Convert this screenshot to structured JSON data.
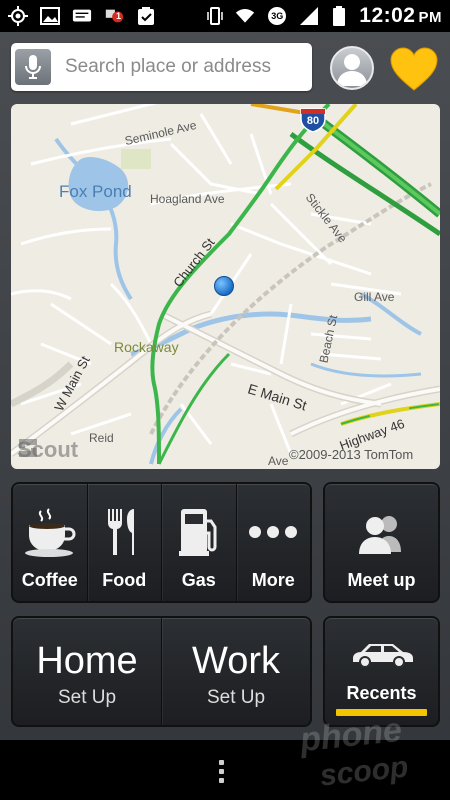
{
  "status_bar": {
    "icons": [
      "gps-icon",
      "image-icon",
      "message-icon",
      "notification-badge-icon",
      "clipboard-check-icon"
    ],
    "notification_count": "1",
    "right_icons": [
      "vibrate-icon",
      "wifi-icon",
      "3g-icon",
      "signal-icon",
      "battery-icon"
    ],
    "network": "3G",
    "time": "12:02",
    "ampm": "PM"
  },
  "search": {
    "placeholder": "Search place or address"
  },
  "map": {
    "labels": {
      "fox_pond": "Fox Pond",
      "rockaway": "Rockaway",
      "hoagland": "Hoagland Ave",
      "seminole": "Seminole Ave",
      "church": "Church St",
      "w_main": "W Main St",
      "e_main": "E Main St",
      "stickle": "Stickle Ave",
      "gill": "Gill Ave",
      "beach": "Beach St",
      "reid": "Reid",
      "highway": "Highway 46",
      "ave": "Ave"
    },
    "interstate": "80",
    "copyright": "©2009-2013 TomTom",
    "logo": "Scout"
  },
  "categories": [
    {
      "label": "Coffee",
      "icon": "coffee-cup-icon"
    },
    {
      "label": "Food",
      "icon": "fork-knife-icon"
    },
    {
      "label": "Gas",
      "icon": "gas-pump-icon"
    },
    {
      "label": "More",
      "icon": "more-dots-icon"
    }
  ],
  "meet_up": {
    "label": "Meet up",
    "icon": "people-icon"
  },
  "home": {
    "title": "Home",
    "sub": "Set Up"
  },
  "work": {
    "title": "Work",
    "sub": "Set Up"
  },
  "recents": {
    "label": "Recents",
    "icon": "car-icon"
  },
  "colors": {
    "accent": "#f5c400",
    "favorite": "#ffc20e",
    "route_green": "#3cb54a"
  },
  "watermark": {
    "line1": "phone",
    "line2": "scoop"
  }
}
